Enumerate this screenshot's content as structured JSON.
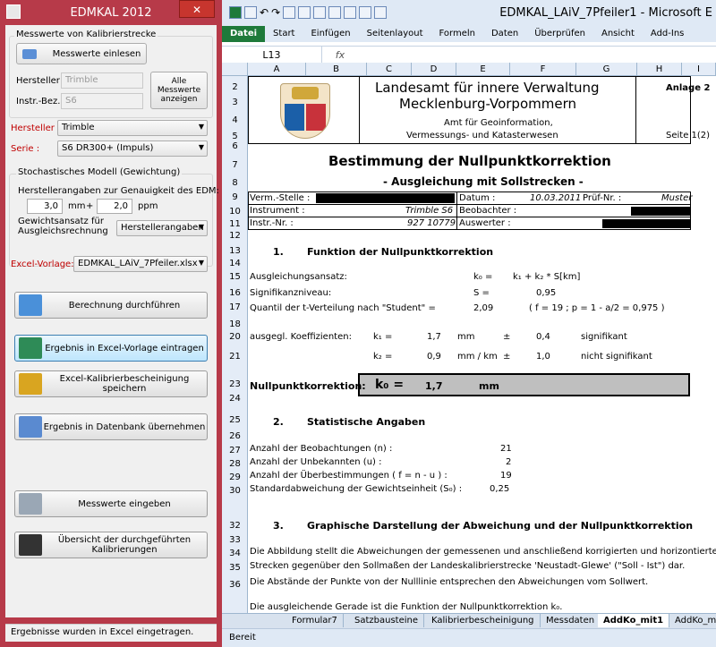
{
  "app": {
    "title": "EDMKAL 2012",
    "close_symbol": "✕",
    "group_measurement": "Messwerte von Kalibrierstrecke",
    "load_button": "Messwerte einlesen",
    "manufacturer_label": "Hersteller :",
    "manufacturer_value": "Trimble",
    "instrument_label": "Instr.-Bez. :",
    "instrument_value": "S6",
    "show_all_button": "Alle Messwerte anzeigen",
    "manufacturer_select_label": "Hersteller :",
    "manufacturer_select_value": "Trimble",
    "series_label": "Serie :",
    "series_value": "S6 DR300+ (Impuls)",
    "stochastic_group": "Stochastisches Modell  (Gewichtung)",
    "accuracy_label": "Herstellerangaben zur Genauigkeit des EDM:",
    "accuracy_mm_value": "3,0",
    "accuracy_mm_unit": "mm",
    "plus": "+",
    "accuracy_ppm_value": "2,0",
    "accuracy_ppm_unit": "ppm",
    "weight_label": "Gewichtsansatz für Ausgleichsrechnung",
    "weight_value": "Herstellerangaben",
    "excel_template_label": "Excel-Vorlage:",
    "excel_template_value": "EDMKAL_LAiV_7Pfeiler.xlsx",
    "buttons": {
      "compute": "Berechnung durchführen",
      "to_excel": "Ergebnis in Excel-Vorlage eintragen",
      "save_cert": "Excel-Kalibrierbescheinigung speichern",
      "to_db": "Ergebnis in Datenbank übernehmen",
      "enter_values": "Messwerte eingeben",
      "overview": "Übersicht der durchgeführten Kalibrierungen"
    },
    "status": "Ergebnisse wurden in Excel eingetragen."
  },
  "excel": {
    "title": "EDMKAL_LAiV_7Pfeiler1 - Microsoft E",
    "undo_symbol": "↶",
    "redo_symbol": "↷",
    "tabs": [
      "Datei",
      "Start",
      "Einfügen",
      "Seitenlayout",
      "Formeln",
      "Daten",
      "Überprüfen",
      "Ansicht",
      "Add-Ins"
    ],
    "namebox": "L13",
    "fx": "fx",
    "columns": [
      "A",
      "B",
      "C",
      "D",
      "E",
      "F",
      "G",
      "H",
      "I"
    ],
    "rows": [
      "2",
      "3",
      "4",
      "5",
      "6",
      "7",
      "8",
      "9",
      "10",
      "11",
      "12",
      "13",
      "14",
      "15",
      "16",
      "17",
      "18",
      "19",
      "20",
      "21",
      "22",
      "23",
      "24",
      "25",
      "26",
      "27",
      "28",
      "29",
      "30",
      "31",
      "32",
      "33",
      "34",
      "35",
      "36"
    ],
    "sheet": {
      "org1": "Landesamt für innere Verwaltung",
      "org2": "Mecklenburg-Vorpommern",
      "annex": "Anlage 2",
      "dept1": "Amt für Geoinformation,",
      "dept2": "Vermessungs- und Katasterwesen",
      "page": "Seite 1(2)",
      "main_title": "Bestimmung der Nullpunktkorrektion",
      "subtitle": "- Ausgleichung mit Sollstrecken -",
      "verm_label": "Verm.-Stelle :",
      "datum_label": "Datum :",
      "datum_value": "10.03.2011",
      "pruef_label": "Prüf-Nr. :",
      "pruef_value": "Muster",
      "instrument_label": "Instrument :",
      "instrument_value": "Trimble S6",
      "beobachter_label": "Beobachter :",
      "instrnr_label": "Instr.-Nr. :",
      "instrnr_value": "927 10779",
      "auswerter_label": "Auswerter :",
      "s1_num": "1.",
      "s1_title": "Funktion der Nullpunktkorrektion",
      "ausgl_label": "Ausgleichungsansatz:",
      "k0_eq": "k₀ =",
      "formula": "k₁ + k₂ * S[km]",
      "sig_label": "Signifikanzniveau:",
      "s_eq": "S =",
      "sig_value": "0,95",
      "quantil_label": "Quantil der t-Verteilung nach \"Student\" =",
      "quantil_value": "2,09",
      "quantil_note": "( f = 19 ;    p = 1 - a/2 = 0,975 )",
      "coef_label": "ausgegl. Koeffizienten:",
      "k1_label": "k₁ =",
      "k1_value": "1,7",
      "k1_unit": "mm",
      "pm": "±",
      "k1_sd": "0,4",
      "k1_sig": "signifikant",
      "k2_label": "k₂ =",
      "k2_value": "0,9",
      "k2_unit": "mm / km",
      "k2_sd": "1,0",
      "k2_sig": "nicht signifikant",
      "npk_label": "Nullpunktkorrektion:",
      "npk_k0": "k₀ =",
      "npk_value": "1,7",
      "npk_unit": "mm",
      "s2_num": "2.",
      "s2_title": "Statistische Angaben",
      "obs_label": "Anzahl der Beobachtungen  (n) :",
      "obs_value": "21",
      "unk_label": "Anzahl der Unbekannten  (u) :",
      "unk_value": "2",
      "redund_label": "Anzahl der Überbestimmungen   ( f = n - u ) :",
      "redund_value": "19",
      "std_label": "Standardabweichung der Gewichtseinheit  (S₀) :",
      "std_value": "0,25",
      "s3_num": "3.",
      "s3_title": "Graphische Darstellung der Abweichung und der Nullpunktkorrektion",
      "p1": "Die Abbildung stellt die Abweichungen der gemessenen und anschließend korrigierten und horizontierten",
      "p2": "Strecken gegenüber den Sollmaßen der Landeskalibrierstrecke 'Neustadt-Glewe' (\"Soll - Ist\") dar.",
      "p3": "Die Abstände der Punkte von der Nulllinie entsprechen den Abweichungen vom Sollwert.",
      "p4": "Die ausgleichende Gerade ist die Funktion der Nullpunktkorrektion k₀."
    },
    "sheet_tabs": [
      "Formular7",
      "Satzbausteine",
      "Kalibrierbescheinigung",
      "Messdaten",
      "AddKo_mit1",
      "AddKo_m"
    ],
    "status": "Bereit"
  }
}
